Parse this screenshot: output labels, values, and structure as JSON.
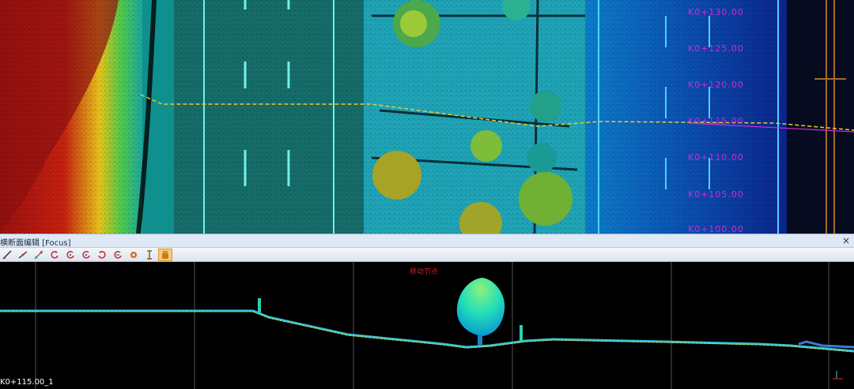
{
  "top_view": {
    "station_labels": [
      "K0+130.00",
      "K0+125.00",
      "K0+120.00",
      "K0+115.00",
      "K0+110.00",
      "K0+105.00",
      "K0+100.00"
    ],
    "colors": {
      "station_label": "#d12bd3",
      "centerline": "#d12bd3",
      "section_line": "#e8c93a"
    }
  },
  "panel": {
    "title": "横断面编辑 [Focus]",
    "close_label": "×"
  },
  "toolbar": {
    "buttons": [
      {
        "icon": "edit-line-icon"
      },
      {
        "icon": "edit-slope-icon"
      },
      {
        "icon": "edit-node-icon"
      },
      {
        "icon": "rotate-icon"
      },
      {
        "icon": "rotate-add-icon"
      },
      {
        "icon": "rotate-plus-icon"
      },
      {
        "icon": "rotate-back-icon"
      },
      {
        "icon": "rotate-reset-icon"
      },
      {
        "icon": "settings-icon"
      },
      {
        "icon": "cursor-text-icon"
      },
      {
        "icon": "hand-pan-icon",
        "active": true
      }
    ]
  },
  "section_view": {
    "status_text": "移动节点",
    "section_name": "K0+115.00_1",
    "colors": {
      "background": "#000000",
      "grid": "#555555",
      "ground": "#31c6d8",
      "tree": "#2fd6b8"
    }
  }
}
